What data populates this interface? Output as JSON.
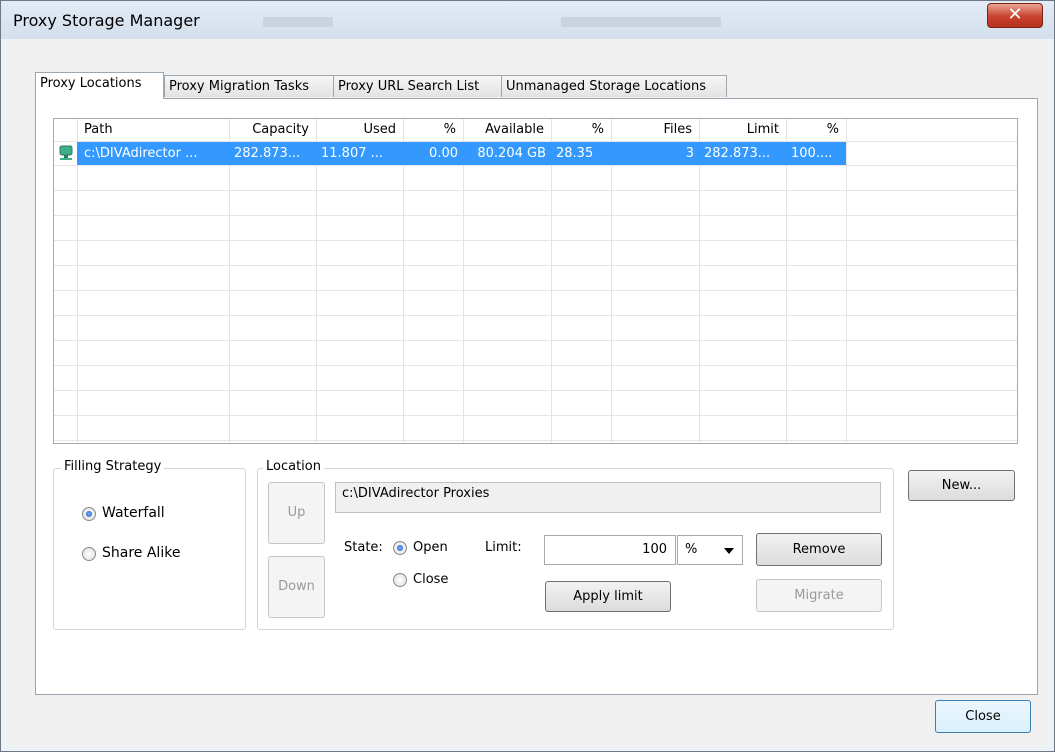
{
  "window": {
    "title": "Proxy Storage Manager",
    "close_glyph": "✕"
  },
  "tabs": [
    {
      "label": "Proxy Locations"
    },
    {
      "label": "Proxy Migration Tasks"
    },
    {
      "label": "Proxy URL Search List"
    },
    {
      "label": "Unmanaged Storage Locations"
    }
  ],
  "table": {
    "headers": [
      "Path",
      "Capacity",
      "Used",
      "%",
      "Available",
      "%",
      "Files",
      "Limit",
      "%"
    ],
    "rows": [
      {
        "icon": "storage-drive-icon",
        "cells": [
          "c:\\DIVAdirector ...",
          "282.873...",
          "11.807 ...",
          "0.00",
          "80.204 GB",
          "28.35",
          "3",
          "282.873...",
          "100...."
        ]
      }
    ]
  },
  "filling_strategy": {
    "label": "Filling Strategy",
    "options": [
      {
        "label": "Waterfall",
        "selected": true
      },
      {
        "label": "Share Alike",
        "selected": false
      }
    ]
  },
  "location": {
    "label": "Location",
    "path": "c:\\DIVAdirector Proxies",
    "up_label": "Up",
    "down_label": "Down",
    "state_label": "State:",
    "state_options": [
      {
        "label": "Open",
        "selected": true
      },
      {
        "label": "Close",
        "selected": false
      }
    ],
    "limit_label": "Limit:",
    "limit_value": "100",
    "limit_unit": "%",
    "apply_label": "Apply limit",
    "remove_label": "Remove",
    "migrate_label": "Migrate"
  },
  "new_label": "New...",
  "close_label": "Close",
  "colors": {
    "selection": "#3399ff",
    "close_button": "#c8412c"
  }
}
